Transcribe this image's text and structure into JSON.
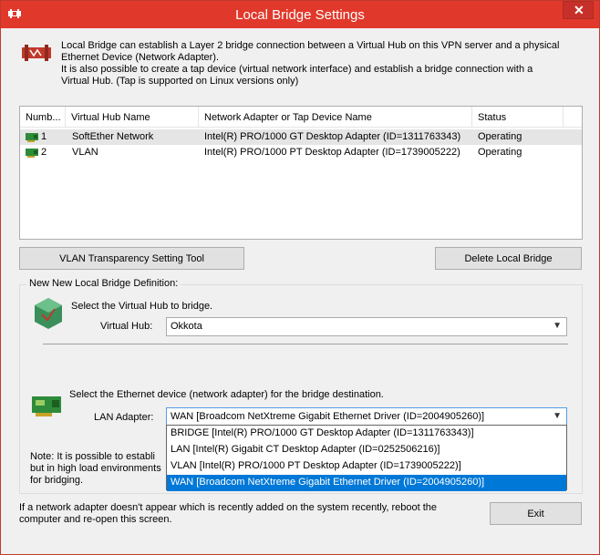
{
  "window": {
    "title": "Local Bridge Settings",
    "close_glyph": "✕"
  },
  "intro": {
    "line1": "Local Bridge can establish a Layer 2 bridge connection between a Virtual Hub on this VPN server and a physical",
    "line2": "Ethernet Device (Network Adapter).",
    "line3": "It is also possible to create a tap device (virtual network interface) and establish a bridge connection with a",
    "line4": "Virtual Hub. (Tap is supported on Linux versions only)"
  },
  "bridge_table": {
    "columns": [
      "Numb...",
      "Virtual Hub Name",
      "Network Adapter or Tap Device Name",
      "Status"
    ],
    "rows": [
      {
        "number": "1",
        "hub": "SoftEther Network",
        "adapter": "Intel(R) PRO/1000 GT Desktop Adapter (ID=1311763343)",
        "status": "Operating"
      },
      {
        "number": "2",
        "hub": "VLAN",
        "adapter": "Intel(R) PRO/1000 PT Desktop Adapter (ID=1739005222)",
        "status": "Operating"
      }
    ]
  },
  "buttons": {
    "vlan_tool": "VLAN Transparency Setting Tool",
    "delete": "Delete Local Bridge",
    "exit": "Exit"
  },
  "definition": {
    "group_label": "New New Local Bridge Definition:",
    "hub_prompt": "Select the Virtual Hub to bridge.",
    "hub_label": "Virtual Hub:",
    "hub_value": "Okkota",
    "device_prompt": "Select the Ethernet device (network adapter) for the bridge destination.",
    "lan_label": "LAN Adapter:",
    "lan_value": "WAN [Broadcom NetXtreme Gigabit Ethernet Driver (ID=2004905260)]",
    "lan_options": [
      "BRIDGE [Intel(R) PRO/1000 GT Desktop Adapter (ID=1311763343)]",
      "LAN [Intel(R) Gigabit CT Desktop Adapter (ID=0252506216)]",
      "VLAN [Intel(R) PRO/1000 PT Desktop Adapter (ID=1739005222)]",
      "WAN [Broadcom NetXtreme Gigabit Ethernet Driver (ID=2004905260)]"
    ],
    "note_line1": "Note: It is possible to establi",
    "note_line2": "but in high load environments",
    "note_line3": "for bridging."
  },
  "footer": {
    "line1": "If a network adapter doesn't appear which is recently added on the system recently, reboot the",
    "line2": "computer and re-open this screen."
  },
  "colors": {
    "titlebar": "#e0392b",
    "selection": "#0078d7"
  }
}
